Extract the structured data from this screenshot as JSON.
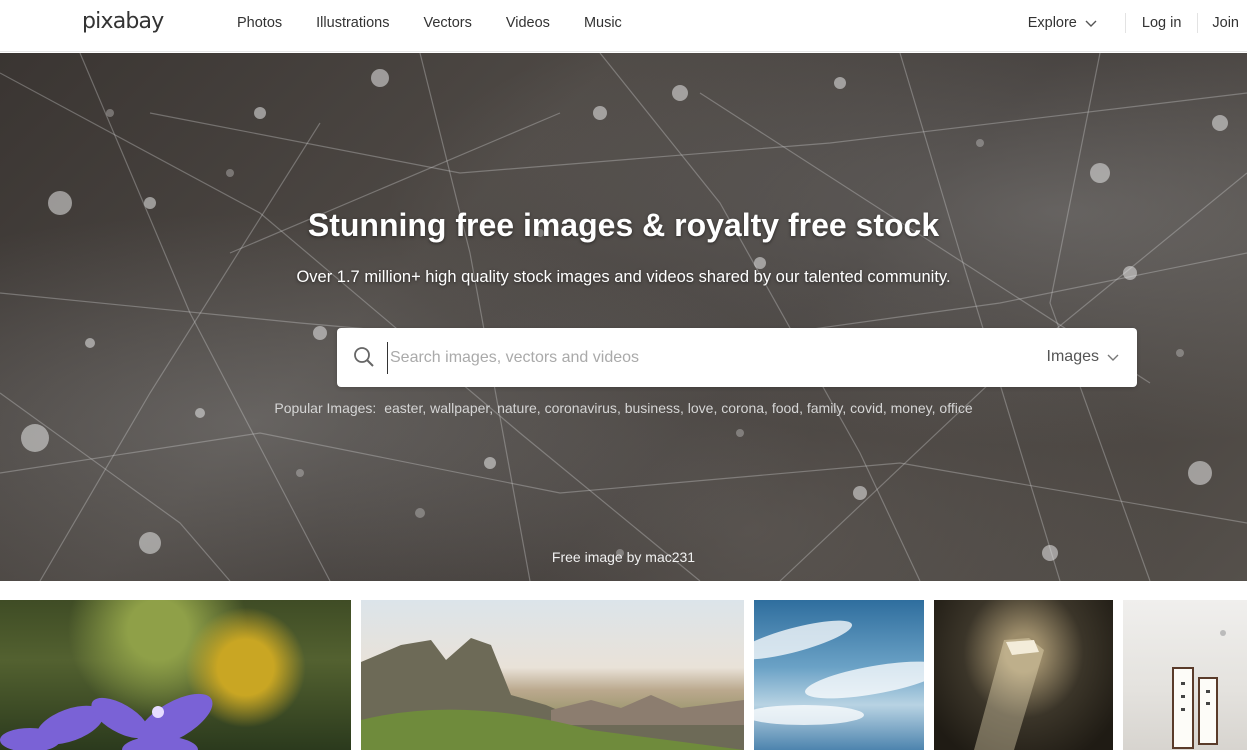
{
  "header": {
    "logo": "pixabay",
    "nav": [
      "Photos",
      "Illustrations",
      "Vectors",
      "Videos",
      "Music"
    ],
    "explore": "Explore",
    "login": "Log in",
    "join": "Join"
  },
  "hero": {
    "title": "Stunning free images & royalty free stock",
    "subtitle": "Over 1.7 million+ high quality stock images and videos shared by our talented community.",
    "search": {
      "placeholder": "Search images, vectors and videos",
      "value": "",
      "type": "Images"
    },
    "popular_label": "Popular Images:",
    "popular_tags": [
      "easter",
      "wallpaper",
      "nature",
      "coronavirus",
      "business",
      "love",
      "corona",
      "food",
      "family",
      "covid",
      "money",
      "office"
    ],
    "credit": "Free image by mac231"
  },
  "icons": {
    "search": "search-icon",
    "chevron": "chevron-down-icon"
  }
}
